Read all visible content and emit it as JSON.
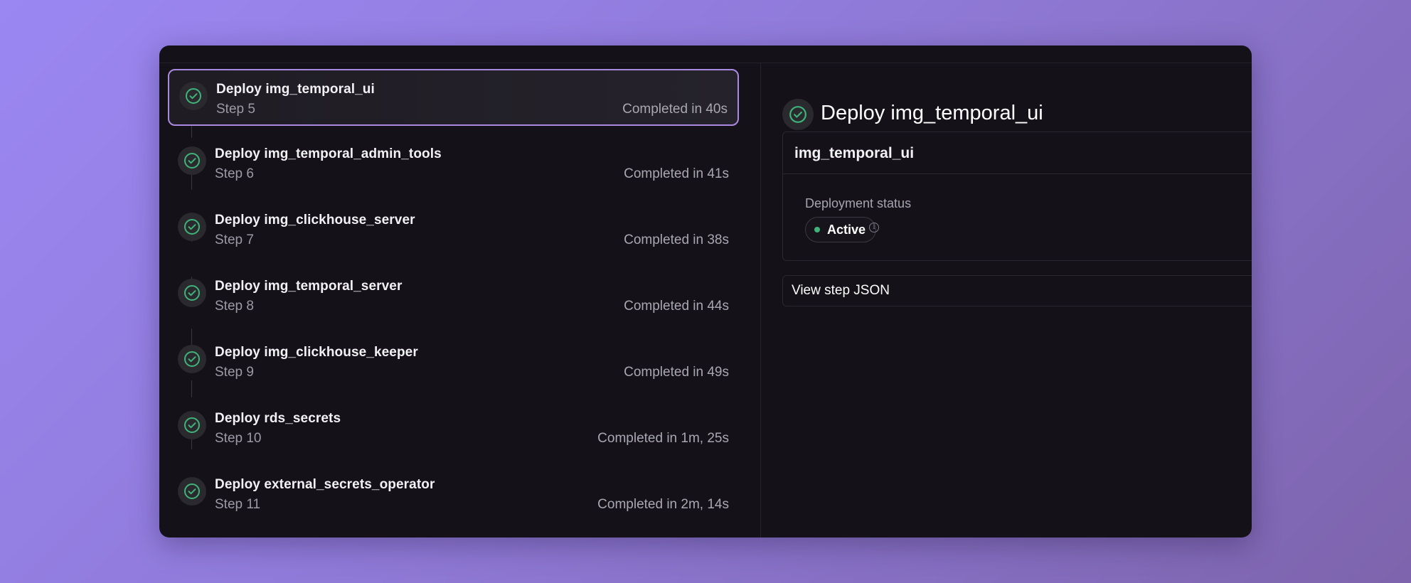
{
  "steps": [
    {
      "title": "Deploy img_temporal_ui",
      "step": "Step 5",
      "time": "Completed in 40s"
    },
    {
      "title": "Deploy img_temporal_admin_tools",
      "step": "Step 6",
      "time": "Completed in 41s"
    },
    {
      "title": "Deploy img_clickhouse_server",
      "step": "Step 7",
      "time": "Completed in 38s"
    },
    {
      "title": "Deploy img_temporal_server",
      "step": "Step 8",
      "time": "Completed in 44s"
    },
    {
      "title": "Deploy img_clickhouse_keeper",
      "step": "Step 9",
      "time": "Completed in 49s"
    },
    {
      "title": "Deploy rds_secrets",
      "step": "Step 10",
      "time": "Completed in 1m, 25s"
    },
    {
      "title": "Deploy external_secrets_operator",
      "step": "Step 11",
      "time": "Completed in 2m, 14s"
    }
  ],
  "detail": {
    "title": "Deploy img_temporal_ui",
    "card_title": "img_temporal_ui",
    "status_label": "Deployment status",
    "status_value": "Active",
    "info_icon": "i",
    "json_button": "View step JSON"
  },
  "colors": {
    "accent": "#a98ae0",
    "success": "#3fb37a",
    "panel": "#141218"
  },
  "icons": {
    "step": "check-circle-icon",
    "info": "info-icon"
  }
}
